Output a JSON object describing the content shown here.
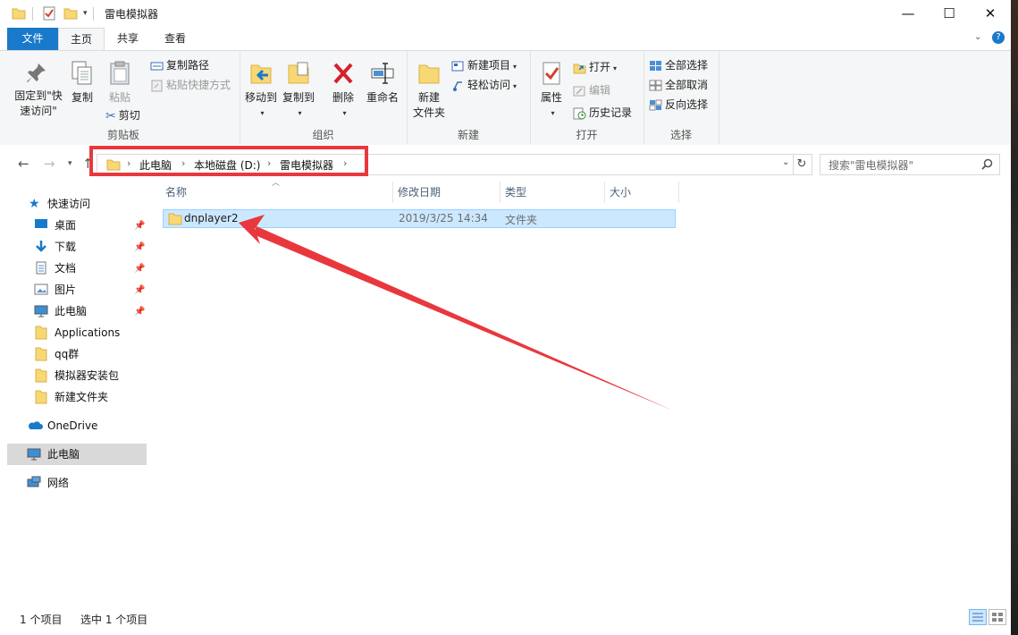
{
  "window": {
    "title": "雷电模拟器"
  },
  "window_controls": {
    "minimize": "—",
    "maximize": "☐",
    "close": "✕"
  },
  "tabs": {
    "file": "文件",
    "home": "主页",
    "share": "共享",
    "view": "查看"
  },
  "ribbon": {
    "clipboard": {
      "pin_label": "固定到\"快速访问\"",
      "copy": "复制",
      "paste": "粘贴",
      "copy_path": "复制路径",
      "paste_shortcut": "粘贴快捷方式",
      "cut": "剪切",
      "group": "剪贴板"
    },
    "organize": {
      "move_to": "移动到",
      "copy_to": "复制到",
      "delete": "删除",
      "rename": "重命名",
      "group": "组织"
    },
    "new": {
      "new_folder": "新建\n文件夹",
      "new_item": "新建项目",
      "easy_access": "轻松访问",
      "group": "新建"
    },
    "open": {
      "properties": "属性",
      "open": "打开",
      "edit": "编辑",
      "history": "历史记录",
      "group": "打开"
    },
    "select": {
      "select_all": "全部选择",
      "select_none": "全部取消",
      "invert": "反向选择",
      "group": "选择"
    }
  },
  "address": {
    "crumbs": [
      "此电脑",
      "本地磁盘 (D:)",
      "雷电模拟器"
    ],
    "search_placeholder": "搜索\"雷电模拟器\""
  },
  "nav": {
    "quick_access": "快速访问",
    "items": [
      "桌面",
      "下载",
      "文档",
      "图片",
      "此电脑",
      "Applications",
      "qq群",
      "模拟器安装包",
      "新建文件夹"
    ],
    "onedrive": "OneDrive",
    "this_pc": "此电脑",
    "network": "网络"
  },
  "columns": {
    "name": "名称",
    "modified": "修改日期",
    "type": "类型",
    "size": "大小"
  },
  "files": [
    {
      "name": "dnplayer2",
      "modified": "2019/3/25 14:34",
      "type": "文件夹",
      "size": ""
    }
  ],
  "status": {
    "count": "1 个项目",
    "selected": "选中 1 个项目"
  },
  "colors": {
    "accent": "#1979ca",
    "annotation": "#e8383d",
    "selection": "#cce8ff",
    "folder": "#f8d775"
  }
}
